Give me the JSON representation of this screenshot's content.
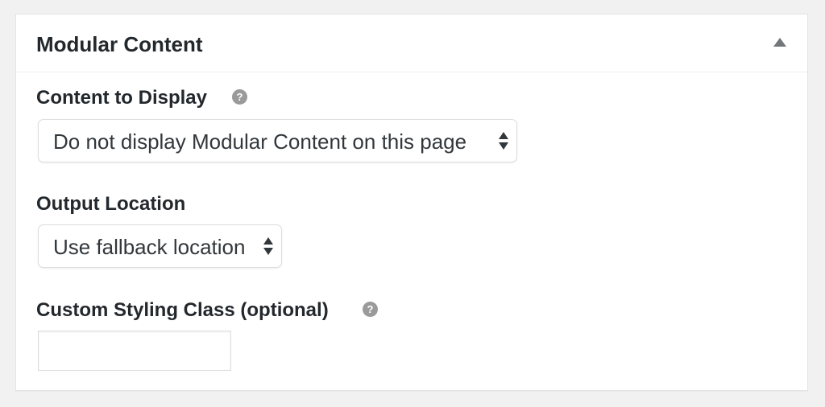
{
  "metabox": {
    "title": "Modular Content",
    "toggle_icon": "triangle-up-icon"
  },
  "fields": {
    "content_to_display": {
      "label": "Content to Display",
      "help_icon": "?",
      "selected": "Do not display Modular Content on this page"
    },
    "output_location": {
      "label": "Output Location",
      "selected": "Use fallback location"
    },
    "custom_styling_class": {
      "label": "Custom Styling Class (optional)",
      "help_icon": "?",
      "value": "",
      "placeholder": ""
    }
  },
  "colors": {
    "background": "#f1f1f1",
    "panel": "#ffffff",
    "text": "#23282d",
    "help_icon": "#9a9a9a"
  }
}
